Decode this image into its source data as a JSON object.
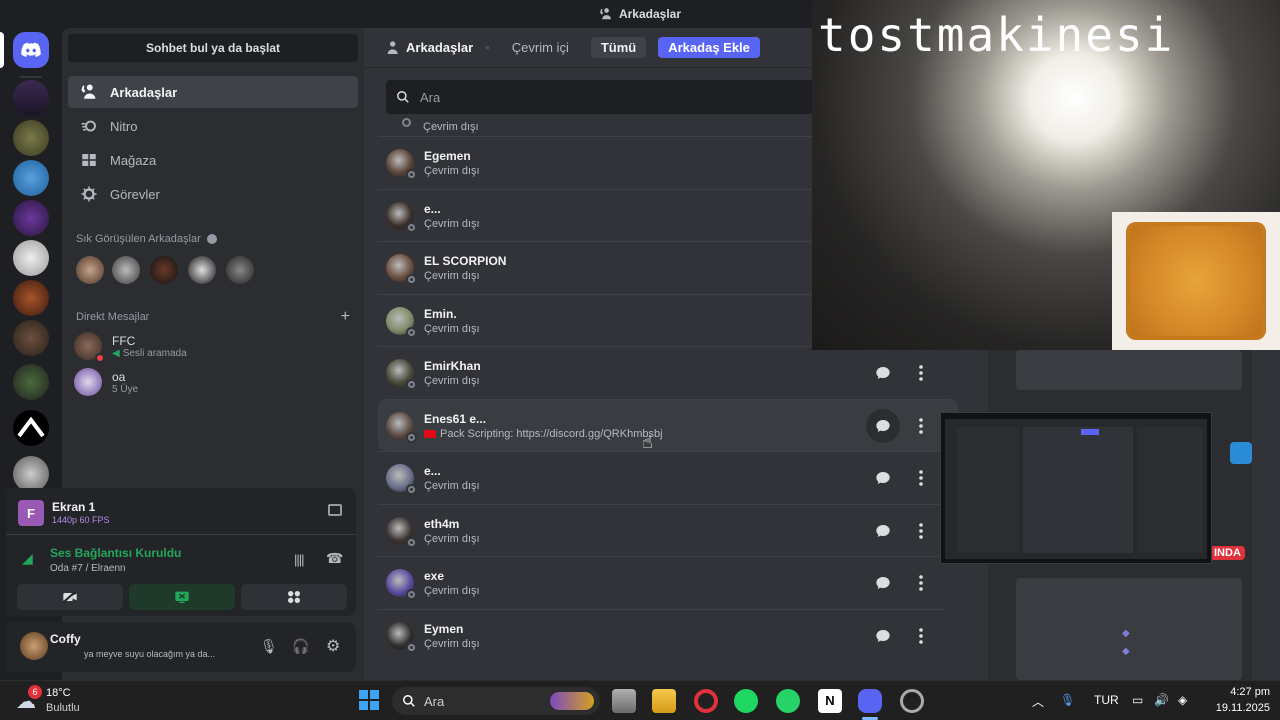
{
  "window": {
    "title": "Arkadaşlar"
  },
  "sidebar": {
    "search_placeholder": "Sohbet bul ya da başlat",
    "nav": [
      {
        "label": "Arkadaşlar",
        "icon": "friends-icon",
        "active": true
      },
      {
        "label": "Nitro",
        "icon": "nitro-icon"
      },
      {
        "label": "Mağaza",
        "icon": "shop-icon"
      },
      {
        "label": "Görevler",
        "icon": "quests-icon"
      }
    ],
    "frequent_header": "Sık Görüşülen Arkadaşlar",
    "dm_header": "Direkt Mesajlar",
    "dms": [
      {
        "name": "FFC",
        "sub": "Sesli aramada"
      },
      {
        "name": "oa",
        "sub": "5 Üye"
      }
    ]
  },
  "screen_share": {
    "name": "Ekran 1",
    "quality": "1440p 60 FPS",
    "voice_status": "Ses Bağlantısı Kuruldu",
    "voice_channel": "Oda #7 / Elraenn"
  },
  "user": {
    "name": "Coffy",
    "status": "ya meyve suyu olacağım ya da..."
  },
  "main": {
    "title": "Arkadaşlar",
    "tabs": [
      "Çevrim içi",
      "Tümü"
    ],
    "add_friend": "Arkadaş Ekle",
    "search_placeholder": "Ara",
    "partial_status": "Çevrim dışı",
    "friends": [
      {
        "name": "Egemen",
        "status": "Çevrim dışı",
        "color": "#5a4638"
      },
      {
        "name": "e...",
        "status": "Çevrim dışı",
        "color": "#3a2f2a"
      },
      {
        "name": "EL SCORPION",
        "status": "Çevrim dışı",
        "color": "#6b4e3f"
      },
      {
        "name": "Emin.",
        "status": "Çevrim dışı",
        "color": "#7f8c6a"
      },
      {
        "name": "EmirKhan",
        "status": "Çevrim dışı",
        "color": "#4a4a3a"
      },
      {
        "name": "Enes61 e...",
        "status": "Pack Scripting: https://discord.gg/QRKhmbsbj",
        "color": "#5a4a44"
      },
      {
        "name": "e...",
        "status": "Çevrim dışı",
        "color": "#6a6f8a"
      },
      {
        "name": "eth4m",
        "status": "Çevrim dışı",
        "color": "#3a3330"
      },
      {
        "name": "exe",
        "status": "Çevrim dışı",
        "color": "#5a4aa0"
      },
      {
        "name": "Eymen",
        "status": "Çevrim dışı",
        "color": "#2e2e2e"
      }
    ]
  },
  "overlay": {
    "webcam_text": "tostmakinesi",
    "badge_text": "INDA"
  },
  "taskbar": {
    "weather_temp": "18°C",
    "weather_desc": "Bulutlu",
    "weather_badge": "6",
    "search_placeholder": "Ara",
    "language": "TUR",
    "time": "4:27 pm",
    "date": "19.11.2025"
  },
  "colors": {
    "accent": "#5865f2",
    "online_green": "#23a55a",
    "dnd_red": "#f23f43"
  }
}
